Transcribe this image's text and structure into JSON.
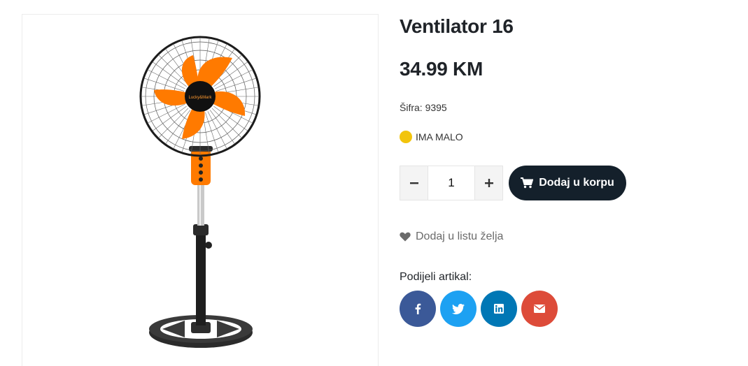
{
  "product": {
    "title": "Ventilator 16",
    "price": "34.99 KM",
    "sku": "Šifra: 9395",
    "stock_label": "IMA MALO",
    "image_brand_text": "Lucky&Mark"
  },
  "cart": {
    "quantity": "1",
    "minus_label": "−",
    "plus_label": "+",
    "add_label": "Dodaj u korpu"
  },
  "wishlist": {
    "label": "Dodaj u listu želja"
  },
  "share": {
    "label": "Podijeli artikal:",
    "buttons": [
      {
        "name": "facebook",
        "icon": "facebook-icon",
        "color": "#3b5998"
      },
      {
        "name": "twitter",
        "icon": "twitter-icon",
        "color": "#1da1f2"
      },
      {
        "name": "linkedin",
        "icon": "linkedin-icon",
        "color": "#0077b5"
      },
      {
        "name": "email",
        "icon": "envelope-icon",
        "color": "#dd4b39"
      }
    ]
  },
  "colors": {
    "stock_indicator": "#f2c40c",
    "cart_button": "#14202b",
    "fan_blades": "#f57c00"
  }
}
